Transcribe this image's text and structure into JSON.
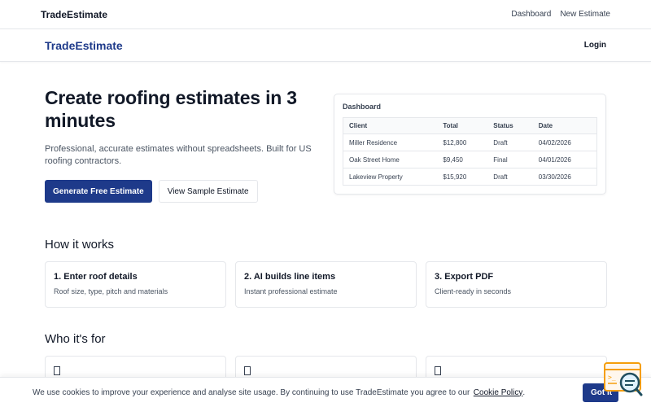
{
  "topbar": {
    "brand": "TradeEstimate",
    "links": [
      "Dashboard",
      "New Estimate"
    ]
  },
  "navbar": {
    "logo": "TradeEstimate",
    "login": "Login"
  },
  "hero": {
    "title": "Create roofing estimates in 3 minutes",
    "subtitle": "Professional, accurate estimates without spreadsheets. Built for US roofing contractors.",
    "primary_button": "Generate Free Estimate",
    "secondary_button": "View Sample Estimate"
  },
  "dashboard": {
    "title": "Dashboard",
    "columns": [
      "Client",
      "Total",
      "Status",
      "Date"
    ],
    "rows": [
      [
        "Miller Residence",
        "$12,800",
        "Draft",
        "04/02/2026"
      ],
      [
        "Oak Street Home",
        "$9,450",
        "Final",
        "04/01/2026"
      ],
      [
        "Lakeview Property",
        "$15,920",
        "Draft",
        "03/30/2026"
      ]
    ]
  },
  "how_it_works": {
    "title": "How it works",
    "steps": [
      {
        "title": "1. Enter roof details",
        "desc": "Roof size, type, pitch and materials"
      },
      {
        "title": "2. AI builds line items",
        "desc": "Instant professional estimate"
      },
      {
        "title": "3. Export PDF",
        "desc": "Client-ready in seconds"
      }
    ]
  },
  "who_its_for": {
    "title": "Who it's for"
  },
  "cookie": {
    "text": "We use cookies to improve your experience and analyse site usage. By continuing to use TradeEstimate you agree to our",
    "link": "Cookie Policy",
    "period": ".",
    "button": "Got it"
  },
  "icons": {
    "chat": "chat-widget-icon",
    "placeholder": "placeholder-box-icon"
  },
  "colors": {
    "primary": "#1e3a8a",
    "text": "#111827",
    "muted": "#4b5563",
    "border": "#e5e7eb",
    "chat_accent": "#f59e0b",
    "chat_dark": "#1f4e5f"
  }
}
